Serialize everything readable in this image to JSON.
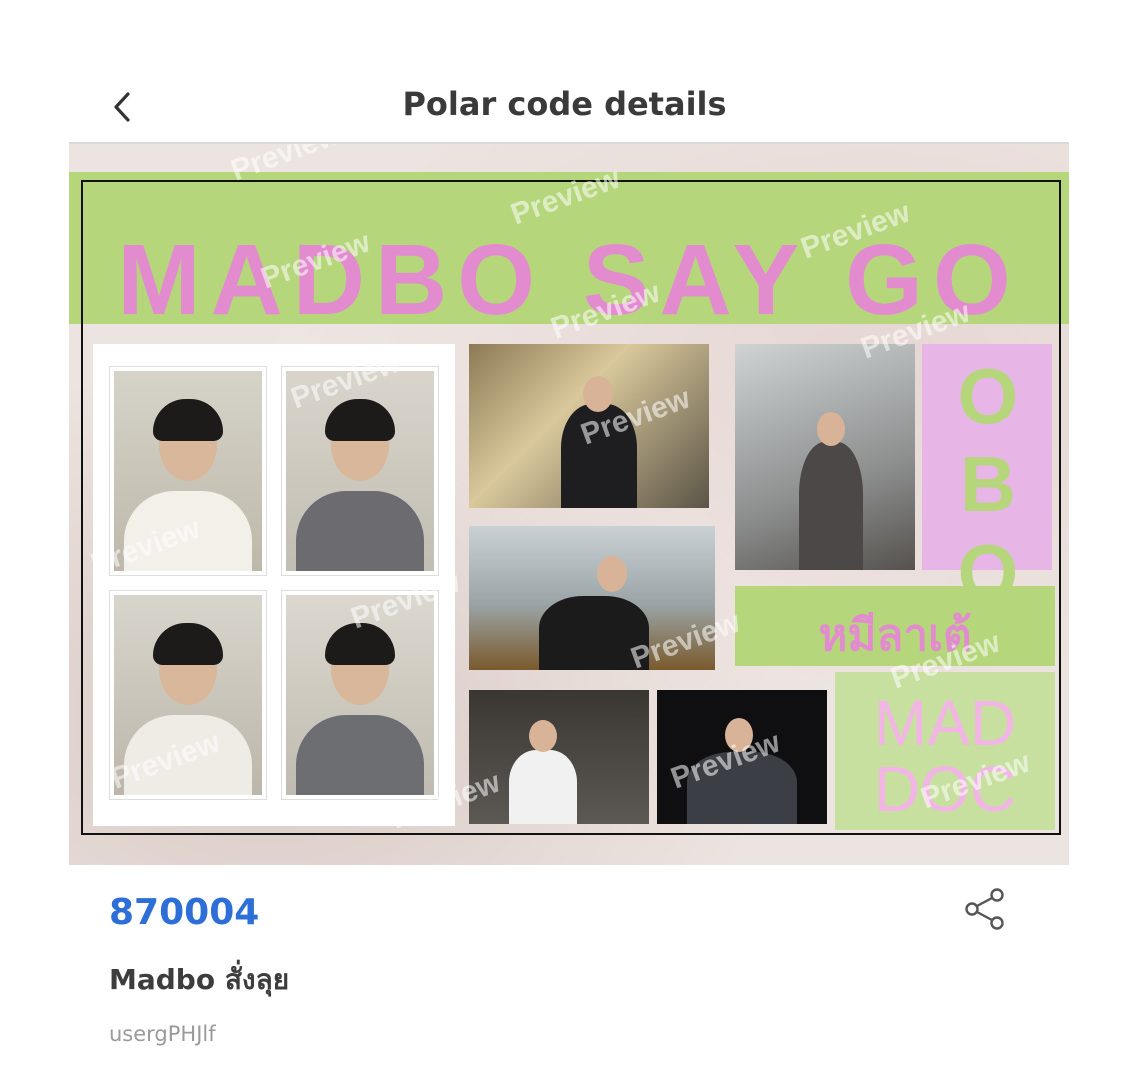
{
  "header": {
    "title": "Polar code details",
    "back_icon": "chevron-left-icon"
  },
  "preview": {
    "watermark": "Preview",
    "banner_text": "MADBO SAY GO",
    "side_text": "OBO",
    "thai_text": "หมีลาเต้",
    "mad_doc_text": "MAD DOC",
    "colors": {
      "green": "#b6d67c",
      "pink": "#e28ccf",
      "lilac": "#e7b6e6"
    }
  },
  "detail": {
    "code": "870004",
    "name": "Madbo สั่งลุย",
    "user": "usergPHJlf",
    "share_icon": "share-icon",
    "code_color": "#2d6fd6"
  }
}
